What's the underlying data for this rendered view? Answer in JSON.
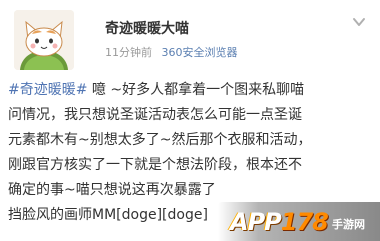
{
  "post": {
    "user_name": "奇迹暖暖大喵",
    "time": "11分钟前",
    "source": "360安全浏览器",
    "hashtag": "#奇迹暖暖#",
    "text": " 噫 ~好多人都拿着一个图来私聊喵\n问情况，我只想说圣诞活动表怎么可能一点圣诞\n元素都木有~别想太多了~然后那个衣服和活动，\n刚跟官方核实了一下就是个想法阶段，根本还不\n确定的事~喵只想说这再次暴露了\n挡脸风的画师MM[doge][doge]"
  },
  "watermark": {
    "logo_prefix": "APP",
    "logo_digits": "178",
    "logo_suffix": "手游网"
  }
}
